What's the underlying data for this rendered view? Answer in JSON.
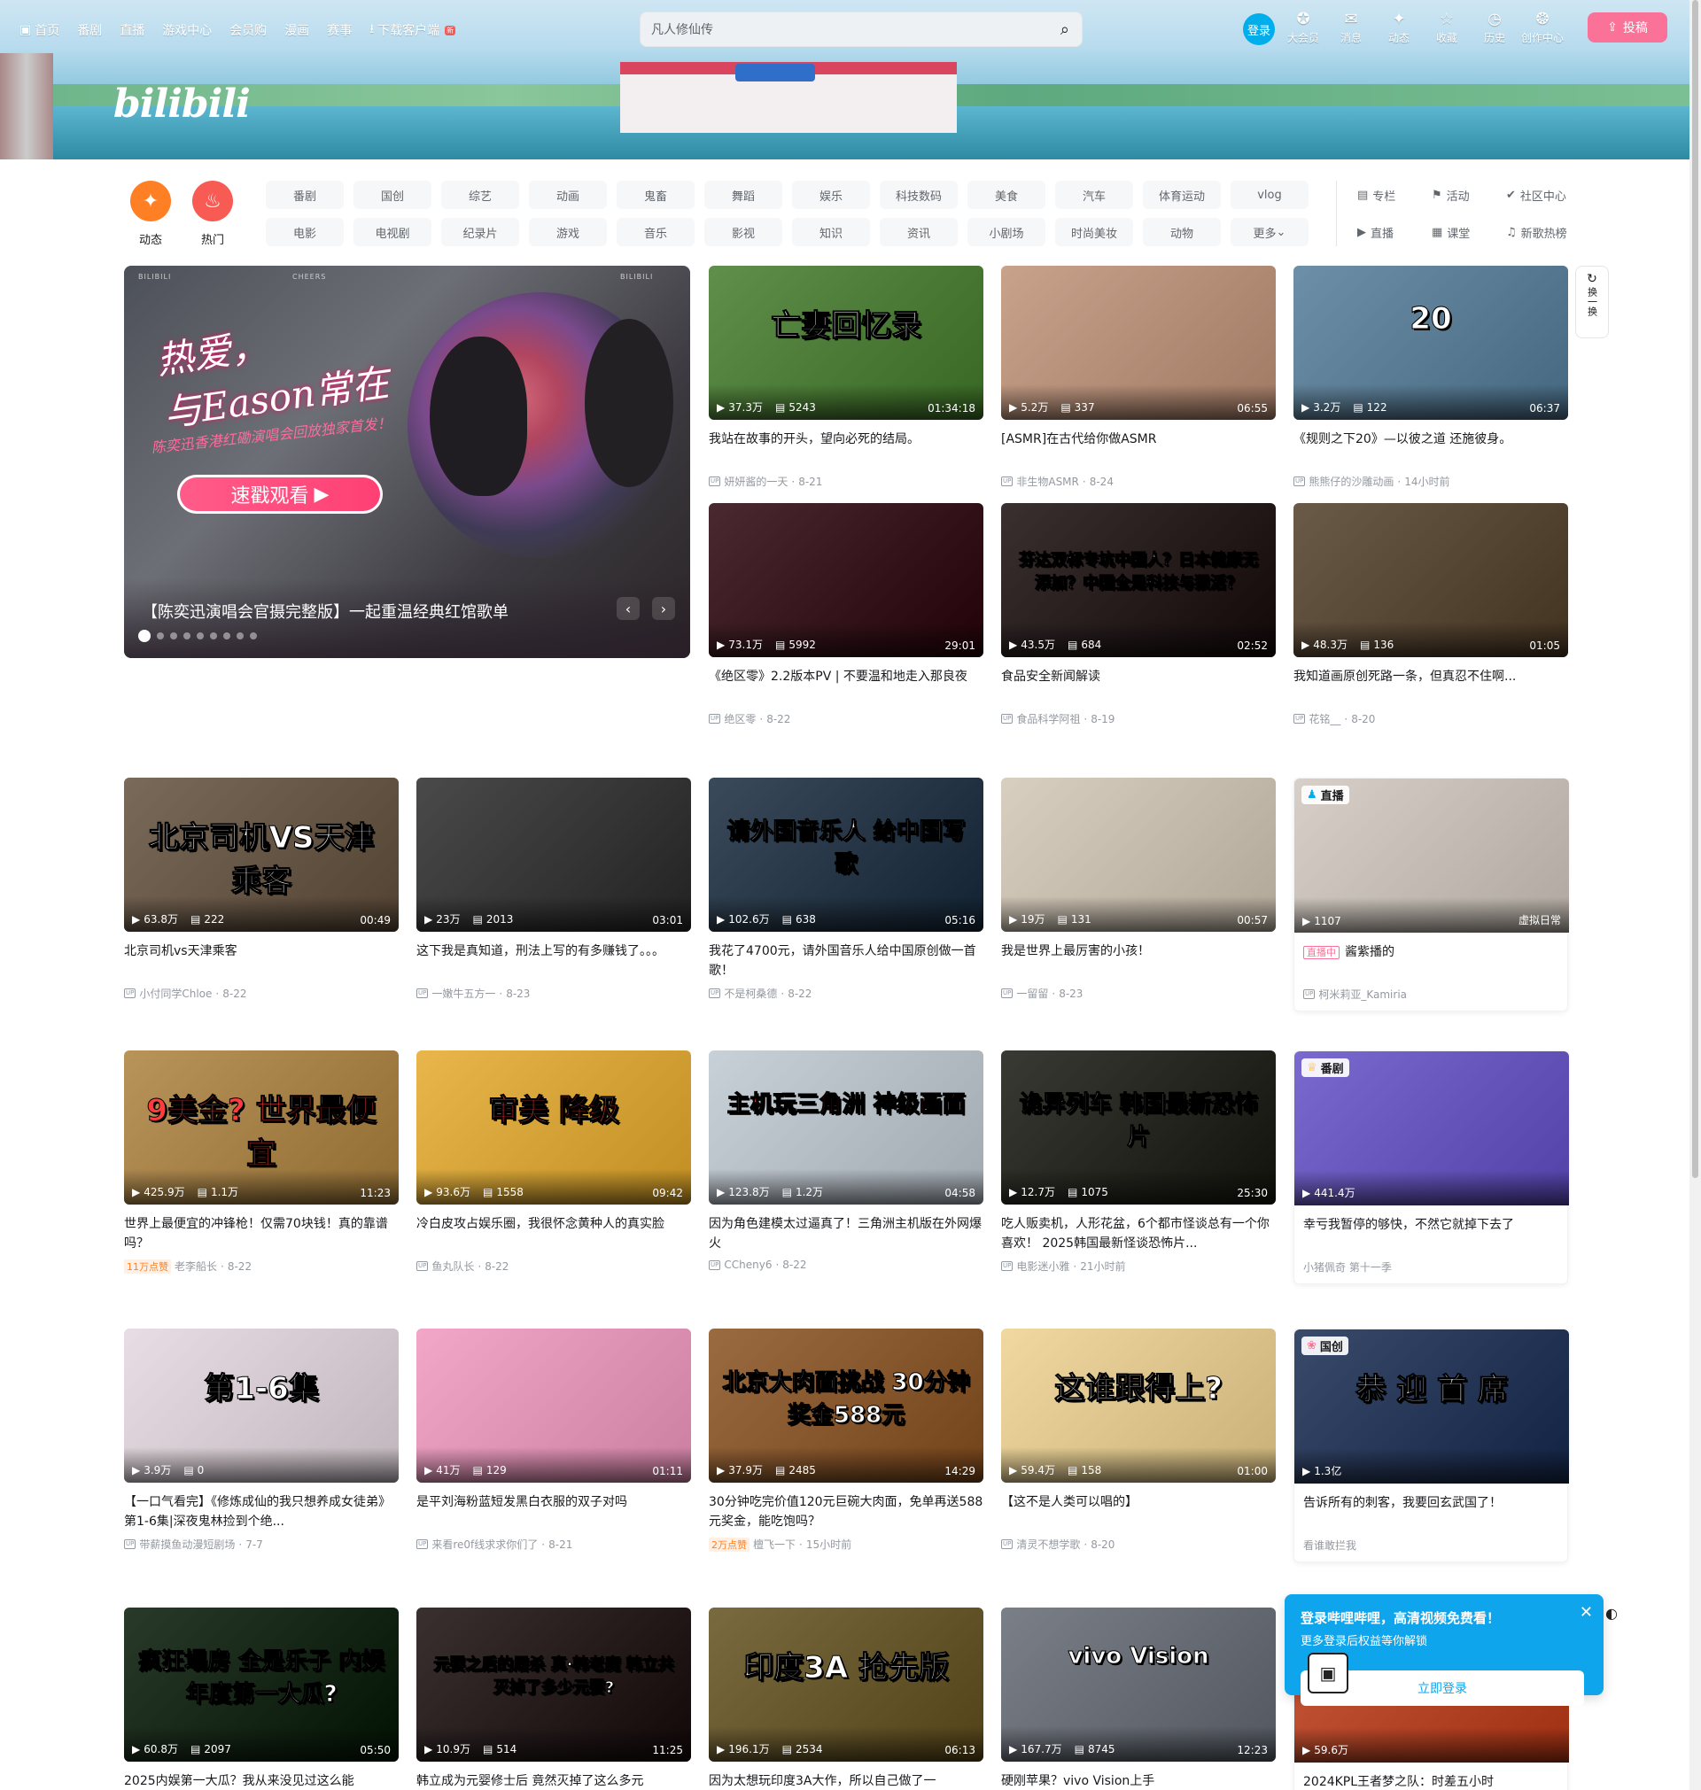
{
  "nav": {
    "left": [
      {
        "icon": "tv-icon",
        "label": "首页"
      },
      {
        "label": "番剧"
      },
      {
        "label": "直播"
      },
      {
        "label": "游戏中心"
      },
      {
        "label": "会员购"
      },
      {
        "label": "漫画"
      },
      {
        "label": "赛事"
      },
      {
        "icon": "download-icon",
        "label": "下载客户端",
        "badge": "新"
      }
    ],
    "search_placeholder": "凡人修仙传",
    "login": "登录",
    "right": [
      {
        "icon": "vip-icon",
        "label": "大会员"
      },
      {
        "icon": "message-icon",
        "label": "消息"
      },
      {
        "icon": "dynamic-icon",
        "label": "动态"
      },
      {
        "icon": "star-icon",
        "label": "收藏"
      },
      {
        "icon": "clock-icon",
        "label": "历史"
      },
      {
        "icon": "bulb-icon",
        "label": "创作中心"
      }
    ],
    "upload": "投稿"
  },
  "brand": "bilibili",
  "channels": {
    "dynamic": "动态",
    "hot": "热门",
    "items": [
      "番剧",
      "国创",
      "综艺",
      "动画",
      "鬼畜",
      "舞蹈",
      "娱乐",
      "科技数码",
      "美食",
      "汽车",
      "体育运动",
      "vlog",
      "电影",
      "电视剧",
      "纪录片",
      "游戏",
      "音乐",
      "影视",
      "知识",
      "资讯",
      "小剧场",
      "时尚美妆",
      "动物",
      "更多"
    ],
    "extra": [
      {
        "icon": "column-icon",
        "label": "专栏"
      },
      {
        "icon": "flag-icon",
        "label": "活动"
      },
      {
        "icon": "community-icon",
        "label": "社区中心"
      },
      {
        "icon": "live-icon",
        "label": "直播"
      },
      {
        "icon": "classroom-icon",
        "label": "课堂"
      },
      {
        "icon": "music-icon",
        "label": "新歌热榜"
      }
    ]
  },
  "carousel": {
    "headline_1": "热爱，",
    "headline_2": "与Eason常在",
    "sub": "陈奕迅香港红磡演唱会回放独家首发！",
    "cta": "速戳观看",
    "brand_a": "BILIBILI",
    "brand_b": "CHEERS",
    "brand_c": "BILIBILI",
    "title": "【陈奕迅演唱会官摄完整版】一起重温经典红馆歌单",
    "dots": 9,
    "active": 0
  },
  "refresh": {
    "label": "换一换"
  },
  "videos": [
    {
      "text": "亡妻回忆录",
      "views": "37.3万",
      "danmaku": "5243",
      "dur": "01:34:18",
      "title": "我站在故事的开头，望向必死的结局。",
      "up": "妍妍酱的一天",
      "date": "8-21",
      "bg": "#5f8f4a"
    },
    {
      "text": "",
      "views": "5.2万",
      "danmaku": "337",
      "dur": "06:55",
      "title": "[ASMR]在古代给你做ASMR",
      "up": "非生物ASMR",
      "date": "8-24",
      "bg": "#c9a28c"
    },
    {
      "text": "20",
      "views": "3.2万",
      "danmaku": "122",
      "dur": "06:37",
      "title": "《规则之下20》—以彼之道 还施彼身。",
      "up": "熊熊仔的沙雕动画",
      "date": "14小时前",
      "bg": "#6d8fa7"
    },
    {
      "text": "",
      "views": "73.1万",
      "danmaku": "5992",
      "dur": "29:01",
      "title": "《绝区零》2.2版本PV | 不要温和地走入那良夜",
      "up": "绝区零",
      "date": "8-22",
      "bg": "#4a2a30"
    },
    {
      "text": "芬达双标专坑中国人？日本健康无添加？中国全是科技与狠活？",
      "views": "43.5万",
      "danmaku": "684",
      "dur": "02:52",
      "title": "食品安全新闻解读",
      "up": "食品科学阿祖",
      "date": "8-19",
      "bg": "#3a3030"
    },
    {
      "text": "",
      "views": "48.3万",
      "danmaku": "136",
      "dur": "01:05",
      "title": "我知道画原创死路一条，但真忍不住啊...",
      "up": "花铭__",
      "date": "8-20",
      "bg": "#6a5a48"
    },
    {
      "text": "北京司机VS天津乘客",
      "views": "63.8万",
      "danmaku": "222",
      "dur": "00:49",
      "title": "北京司机vs天津乘客",
      "up": "小付同学Chloe",
      "date": "8-22",
      "bg": "#7a6a5a"
    },
    {
      "text": "",
      "views": "23万",
      "danmaku": "2013",
      "dur": "03:01",
      "title": "这下我是真知道，刑法上写的有多赚钱了。。。",
      "up": "一嫩牛五方一",
      "date": "8-23",
      "bg": "#4a4a4a"
    },
    {
      "text": "请外国音乐人 给中国写歌",
      "views": "102.6万",
      "danmaku": "638",
      "dur": "05:16",
      "title": "我花了4700元，请外国音乐人给中国原创做一首歌！",
      "up": "不是柯桑德",
      "date": "8-22",
      "bg": "#3a4a5a"
    },
    {
      "text": "",
      "views": "19万",
      "danmaku": "131",
      "dur": "00:57",
      "title": "我是世界上最厉害的小孩！",
      "up": "一留留",
      "date": "8-23",
      "bg": "#d9cfc0"
    },
    {
      "text": "9美金? 世界最便宜",
      "views": "425.9万",
      "danmaku": "1.1万",
      "dur": "11:23",
      "title": "世界上最便宜的冲锋枪！仅需70块钱！真的靠谱吗？",
      "up": "老李船长",
      "date": "8-22",
      "badge": "11万点赞",
      "bg": "#b8945a"
    },
    {
      "text": "审美 降级",
      "views": "93.6万",
      "danmaku": "1558",
      "dur": "09:42",
      "title": "冷白皮攻占娱乐圈，我很怀念黄种人的真实脸",
      "up": "鱼丸队长",
      "date": "8-22",
      "bg": "#e8b64a"
    },
    {
      "text": "主机玩三角洲 神级画面",
      "views": "123.8万",
      "danmaku": "1.2万",
      "dur": "04:58",
      "title": "因为角色建模太过逼真了！三角洲主机版在外网爆火",
      "up": "CCheny6",
      "date": "8-22",
      "bg": "#c8d0d8"
    },
    {
      "text": "诡异列车 韩国最新恐怖片",
      "views": "12.7万",
      "danmaku": "1075",
      "dur": "25:30",
      "title": "吃人贩卖机，人形花盆，6个都市怪谈总有一个你喜欢！ 2025韩国最新怪谈恐怖片...",
      "up": "电影迷小雅",
      "date": "21小时前",
      "bg": "#3a3a34"
    },
    {
      "text": "第1-6集",
      "views": "3.9万",
      "danmaku": "0",
      "dur": "",
      "title": "【一口气看完】《修炼成仙的我只想养成女徒弟》第1-6集|深夜鬼林捡到个绝...",
      "up": "带薪摸鱼动漫短剧场",
      "date": "7-7",
      "bg": "#e8dde4"
    },
    {
      "text": "",
      "views": "41万",
      "danmaku": "129",
      "dur": "01:11",
      "title": "是平刘海粉蓝短发黑白衣服的双子对吗",
      "up": "来看re0f线求求你们了",
      "date": "8-21",
      "bg": "#f2a6c8"
    },
    {
      "text": "北京大肉面挑战 30分钟奖金588元",
      "views": "37.9万",
      "danmaku": "2485",
      "dur": "14:29",
      "title": "30分钟吃完价值120元巨碗大肉面，免单再送588元奖金，能吃饱吗？",
      "up": "檀飞一下",
      "date": "15小时前",
      "badge": "2万点赞",
      "bg": "#9a6a40"
    },
    {
      "text": "这谁跟得上?",
      "views": "59.4万",
      "danmaku": "158",
      "dur": "01:00",
      "title": "【这不是人类可以唱的】",
      "up": "清灵不想学歌",
      "date": "8-20",
      "bg": "#f0d8a0"
    },
    {
      "text": "疯狂塌房 全是乐子 内娱年度第一大瓜?",
      "views": "60.8万",
      "danmaku": "2097",
      "dur": "05:50",
      "title": "2025内娱第一大瓜？我从来没见过这么能",
      "up": "",
      "date": "",
      "bg": "#2a3a2a"
    },
    {
      "text": "元婴之后的屠杀 真·韩老魔 韩立共灭掉了多少元婴?",
      "views": "10.9万",
      "danmaku": "514",
      "dur": "11:25",
      "title": "韩立成为元婴修士后 竟然灭掉了这么多元",
      "up": "",
      "date": "",
      "bg": "#3a3030"
    },
    {
      "text": "印度3A 抢先版",
      "views": "196.1万",
      "danmaku": "2534",
      "dur": "06:13",
      "title": "因为太想玩印度3A大作，所以自己做了一",
      "up": "",
      "date": "",
      "bg": "#7a6a40"
    },
    {
      "text": "vivo Vision",
      "views": "167.7万",
      "danmaku": "8745",
      "dur": "12:23",
      "title": "硬刚苹果？vivo Vision上手",
      "up": "",
      "date": "",
      "bg": "#7a7f88"
    }
  ],
  "special": [
    {
      "tag": "直播",
      "views": "1107",
      "right": "虚拟日常",
      "title": "酱紫播的",
      "live": "直播中",
      "up": "柯米莉亚_Kamiria",
      "bg": "#d8d0c8"
    },
    {
      "tag": "番剧",
      "views": "441.4万",
      "right": "",
      "title": "幸亏我暂停的够快，不然它就掉下去了",
      "up": "小猪佩奇 第十一季",
      "bg": "#7a6ad0"
    },
    {
      "tag": "国创",
      "views": "1.3亿",
      "right": "",
      "title": "告诉所有的刺客，我要回玄武国了！",
      "up": "看谁敢拦我",
      "bg": "#3a4a6a",
      "text": "恭 迎 首 席"
    },
    {
      "tag": "",
      "views": "59.6万",
      "right": "",
      "title": "2024KPL王者梦之队：时差五小时",
      "up": "",
      "bg": "#c8583a"
    }
  ],
  "popup": {
    "title": "登录哔哩哔哩，高清视频免费看！",
    "sub": "更多登录后权益等你解锁",
    "button": "立即登录"
  }
}
